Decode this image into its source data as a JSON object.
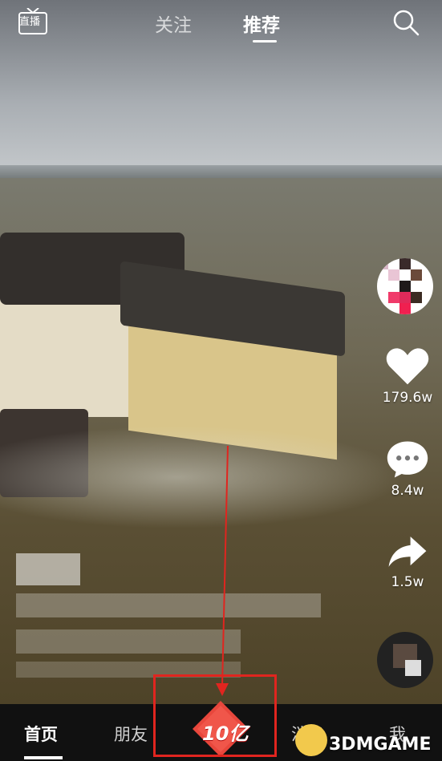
{
  "top_nav": {
    "live_label": "直播",
    "tabs": [
      {
        "label": "关注"
      },
      {
        "label": "推荐"
      }
    ]
  },
  "side_actions": {
    "like_count": "179.6w",
    "comment_count": "8.4w",
    "share_count": "1.5w"
  },
  "bottom_nav": {
    "items": [
      {
        "label": "首页"
      },
      {
        "label": "朋友"
      },
      {
        "label": "消息"
      },
      {
        "label": "我"
      }
    ],
    "center_badge": "10亿"
  },
  "watermark": {
    "text": "3DMGAME"
  },
  "colors": {
    "highlight": "#e0251f",
    "badge_red": "#e8473c"
  }
}
